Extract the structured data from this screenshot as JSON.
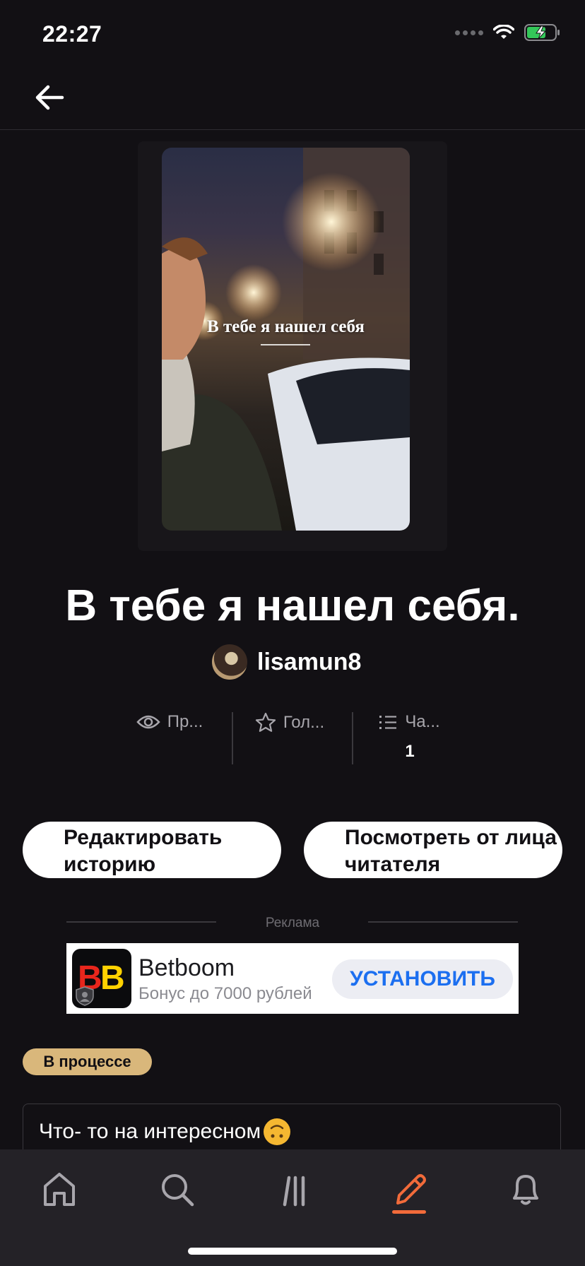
{
  "status_bar": {
    "time": "22:27"
  },
  "story": {
    "cover_title": "В тебе я нашел себя",
    "title": "В тебе я нашел себя.",
    "author": "lisamun8"
  },
  "stats": [
    {
      "icon": "eye-icon",
      "label": "Пр...",
      "value": ""
    },
    {
      "icon": "star-icon",
      "label": "Гол...",
      "value": ""
    },
    {
      "icon": "list-icon",
      "label": "Ча...",
      "value": "1"
    }
  ],
  "buttons": {
    "edit": "Редактировать историю",
    "preview": "Посмотреть от лица читателя"
  },
  "ad": {
    "label": "Реклама",
    "logo_text": "BB",
    "name": "Betboom",
    "subtitle": "Бонус до 7000 рублей",
    "cta": "УСТАНОВИТЬ"
  },
  "status_badge": "В процессе",
  "description": "Что- то на интересном",
  "tabbar": {
    "tabs": [
      "home-icon",
      "search-icon",
      "library-icon",
      "write-icon",
      "bell-icon"
    ],
    "active": "write-icon",
    "accent": "#f26b3a"
  }
}
